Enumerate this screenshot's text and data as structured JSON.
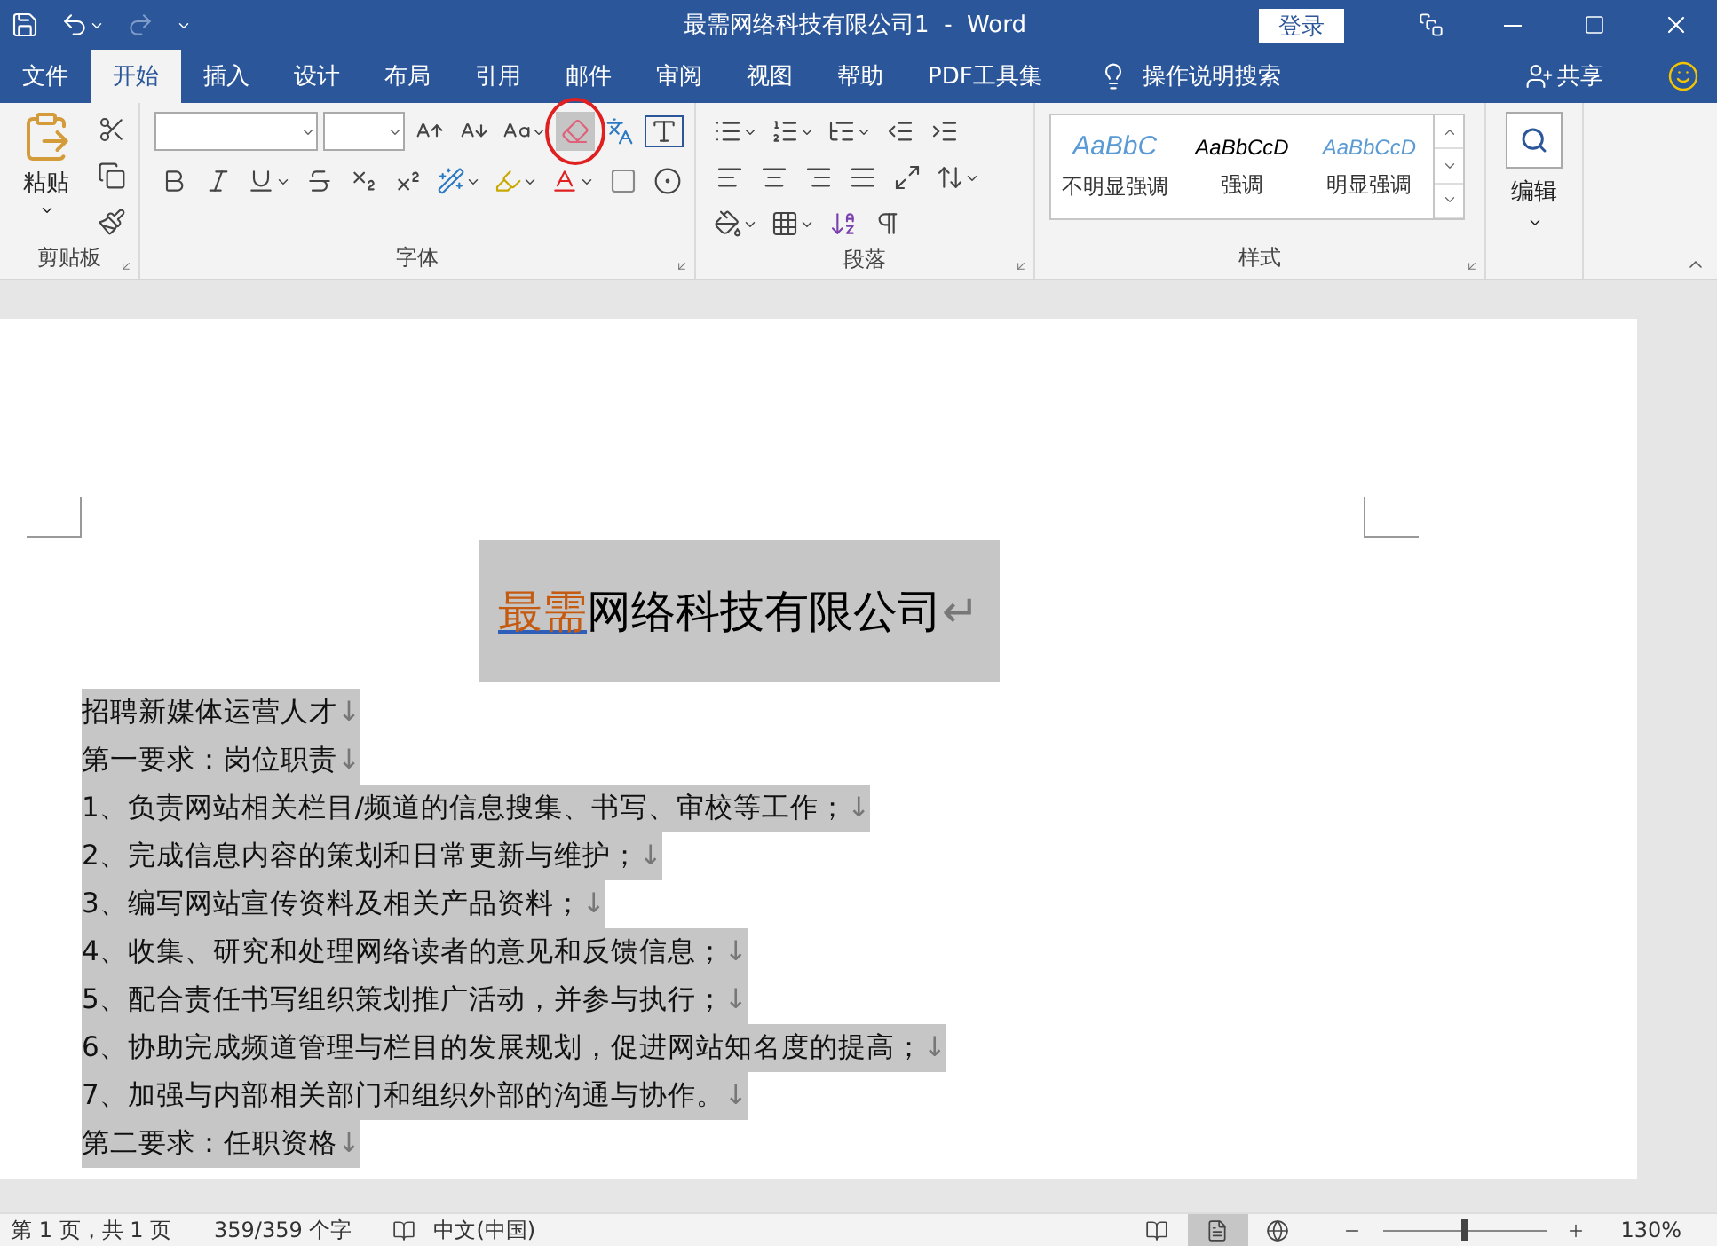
{
  "window": {
    "title": "最需网络科技有限公司1  -  Word",
    "login_button": "登录",
    "redo_disabled": true
  },
  "menu_tabs": [
    {
      "label": "文件",
      "selected": false
    },
    {
      "label": "开始",
      "selected": true
    },
    {
      "label": "插入",
      "selected": false
    },
    {
      "label": "设计",
      "selected": false
    },
    {
      "label": "布局",
      "selected": false
    },
    {
      "label": "引用",
      "selected": false
    },
    {
      "label": "邮件",
      "selected": false
    },
    {
      "label": "审阅",
      "selected": false
    },
    {
      "label": "视图",
      "selected": false
    },
    {
      "label": "帮助",
      "selected": false
    },
    {
      "label": "PDF工具集",
      "selected": false
    }
  ],
  "tell_me": "操作说明搜索",
  "share": "共享",
  "ribbon": {
    "clipboard": {
      "paste": "粘贴",
      "label": "剪贴板"
    },
    "font": {
      "label": "字体",
      "clear_formatting_pressed": true
    },
    "paragraph": {
      "label": "段落"
    },
    "styles": {
      "label": "样式",
      "items": [
        {
          "preview": "AaBbC",
          "label": "不明显强调",
          "kind": "subtle"
        },
        {
          "preview": "AaBbCcD",
          "label": "强调",
          "kind": "emphasis"
        },
        {
          "preview": "AaBbCcD",
          "label": "明显强调",
          "kind": "intense"
        }
      ]
    },
    "editing": {
      "label": "编辑"
    }
  },
  "document": {
    "title": {
      "accent": "最需",
      "rest": "网络科技有限公司",
      "mark": "↵",
      "selected": true
    },
    "lines": [
      {
        "text": "招聘新媒体运营人才",
        "mark": "↓",
        "selected": true
      },
      {
        "text": "第一要求：岗位职责",
        "mark": "↓",
        "selected": true
      },
      {
        "text": "1、负责网站相关栏目/频道的信息搜集、书写、审校等工作；",
        "mark": "↓",
        "selected": true
      },
      {
        "text": "2、完成信息内容的策划和日常更新与维护；",
        "mark": "↓",
        "selected": true
      },
      {
        "text": "3、编写网站宣传资料及相关产品资料；",
        "mark": "↓",
        "selected": true
      },
      {
        "text": "4、收集、研究和处理网络读者的意见和反馈信息；",
        "mark": "↓",
        "selected": true
      },
      {
        "text": "5、配合责任书写组织策划推广活动，并参与执行；",
        "mark": "↓",
        "selected": true
      },
      {
        "text": "6、协助完成频道管理与栏目的发展规划，促进网站知名度的提高；",
        "mark": "↓",
        "selected": true
      },
      {
        "text": "7、加强与内部相关部门和组织外部的沟通与协作。",
        "mark": "↓",
        "selected": true
      },
      {
        "text": "第二要求：任职资格",
        "mark": "↓",
        "selected": true
      }
    ]
  },
  "status_bar": {
    "page": "第 1 页，共 1 页",
    "words": "359/359 个字",
    "language": "中文(中国)",
    "view_buttons": [
      {
        "kind": "read",
        "selected": false
      },
      {
        "kind": "print",
        "selected": true
      },
      {
        "kind": "web",
        "selected": false
      }
    ],
    "zoom": {
      "level": 0.5,
      "reading": "130%"
    }
  }
}
